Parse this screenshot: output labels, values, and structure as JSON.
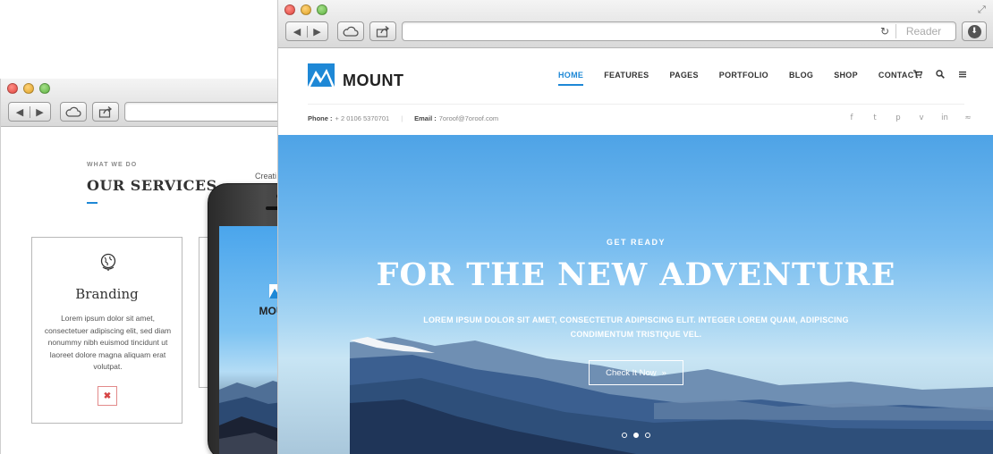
{
  "back_window": {
    "services": {
      "kicker": "WHAT WE DO",
      "title": "OUR SERVICES",
      "card": {
        "icon": "globe-icon",
        "title": "Branding",
        "text": "Lorem ipsum dolor sit amet, consectetuer adipiscing elit, sed diam nonummy nibh euismod tincidunt ut laoreet dolore magna aliquam erat volutpat.",
        "action_icon": "close-icon",
        "action_glyph": "✖"
      },
      "next_card_peek": "Creati"
    },
    "phone": {
      "brand": "MOUNT"
    }
  },
  "front_window": {
    "toolbar": {
      "back_glyph": "◀",
      "forward_glyph": "▶",
      "reload_glyph": "↻",
      "reader_label": "Reader",
      "download_glyph": "⬇",
      "fullscreen_glyph": "⤢"
    },
    "header": {
      "brand": "MOUNT",
      "nav": [
        "HOME",
        "FEATURES",
        "PAGES",
        "PORTFOLIO",
        "BLOG",
        "SHOP",
        "CONTACT"
      ],
      "active_nav": "HOME",
      "icons": [
        "cart-icon",
        "search-icon",
        "menu-icon"
      ],
      "icon_glyphs": [
        "🛒",
        "🔍",
        "≡"
      ],
      "phone_label": "Phone :",
      "phone_value": "+ 2 0106 5370701",
      "email_label": "Email :",
      "email_value": "7oroof@7oroof.com",
      "social": [
        {
          "name": "facebook-icon",
          "glyph": "f"
        },
        {
          "name": "twitter-icon",
          "glyph": "t"
        },
        {
          "name": "pinterest-icon",
          "glyph": "p"
        },
        {
          "name": "vimeo-icon",
          "glyph": "v"
        },
        {
          "name": "linkedin-icon",
          "glyph": "in"
        },
        {
          "name": "rss-icon",
          "glyph": "≈"
        }
      ]
    },
    "hero": {
      "kicker": "GET READY",
      "title": "FOR THE NEW ADVENTURE",
      "text": "LOREM IPSUM DOLOR SIT AMET, CONSECTETUR ADIPISCING ELIT. INTEGER LOREM QUAM, ADIPISCING CONDIMENTUM TRISTIQUE VEL.",
      "button_label": "Check It Now",
      "button_glyph": "»",
      "slides": 3,
      "active_slide": 2
    }
  },
  "colors": {
    "accent": "#1e88d6",
    "sky": "#78bdf0",
    "close_red": "#d64545"
  }
}
